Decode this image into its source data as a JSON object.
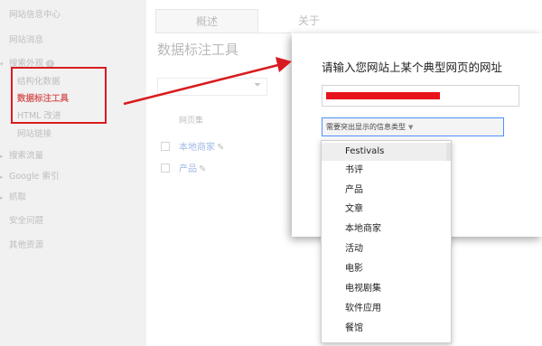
{
  "sidebar": {
    "items": [
      {
        "label": "网站信息中心"
      },
      {
        "label": "网站消息"
      },
      {
        "label": "搜索外观"
      },
      {
        "label": "结构化数据"
      },
      {
        "label": "数据标注工具"
      },
      {
        "label": "HTML 改进"
      },
      {
        "label": "网站链接"
      },
      {
        "label": "搜索流量"
      },
      {
        "label": "Google 索引"
      },
      {
        "label": "抓取"
      },
      {
        "label": "安全问题"
      },
      {
        "label": "其他资源"
      }
    ],
    "info_badge": "i"
  },
  "main": {
    "tabs": [
      {
        "label": "概述"
      },
      {
        "label": "关于"
      }
    ],
    "tool_title": "数据标注工具",
    "column_header": "网页集",
    "rows": [
      {
        "label": "本地商家"
      },
      {
        "label": "产品"
      }
    ]
  },
  "dialog": {
    "title": "请输入您网站上某个典型网页的网址",
    "type_select_label": "需要突出显示的信息类型"
  },
  "dropdown": {
    "options": [
      "Festivals",
      "书评",
      "产品",
      "文章",
      "本地商家",
      "活动",
      "电影",
      "电视剧集",
      "软件应用",
      "餐馆"
    ],
    "highlighted": "Festivals"
  },
  "colors": {
    "annotation_red": "#d81b20",
    "focus_blue": "#4d90fe",
    "active_link": "#d9605f"
  }
}
